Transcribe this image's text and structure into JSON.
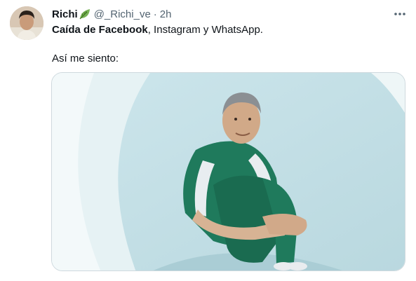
{
  "tweet": {
    "author_name": "Richi",
    "author_handle": "@_Richi_ve",
    "separator": "·",
    "time": "2h",
    "text_bold": "Caída de Facebook",
    "text_rest": ", Instagram y WhatsApp.",
    "text_line2": "Así me siento:",
    "name_emoji_icon": "leaf-icon",
    "more_icon": "more-dots-icon"
  },
  "colors": {
    "text_primary": "#0f1419",
    "text_secondary": "#536471",
    "border": "#cfd9de"
  }
}
